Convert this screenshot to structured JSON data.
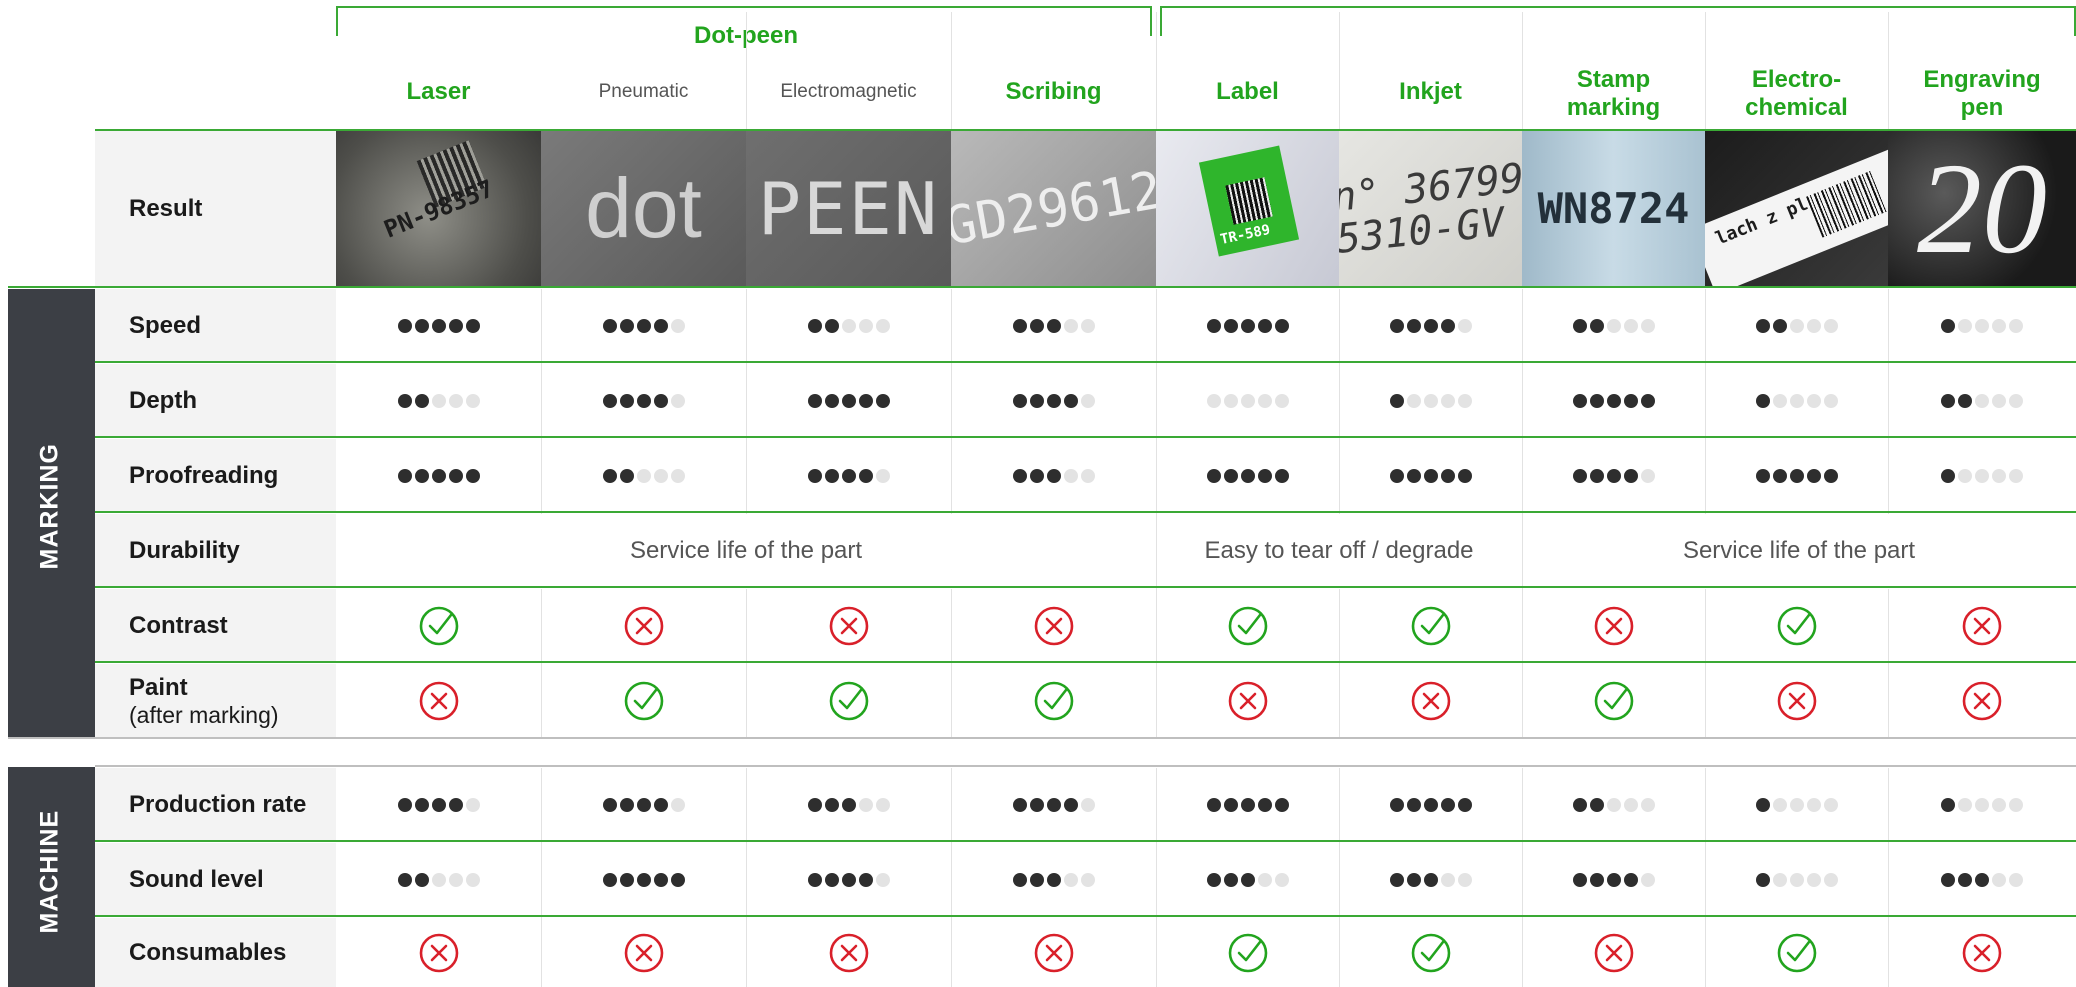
{
  "header": {
    "group_title": "Dot-peen",
    "columns": [
      "Laser",
      "Pneumatic",
      "Electromagnetic",
      "Scribing",
      "Label",
      "Inkjet",
      "Stamp marking",
      "Electro-chemical",
      "Engraving pen"
    ]
  },
  "result": {
    "label": "Result",
    "images": [
      {
        "text": "PN-98357",
        "note": "laser data matrix on metal"
      },
      {
        "text": "dot"
      },
      {
        "text": "PEEN"
      },
      {
        "text": "GD29612"
      },
      {
        "text": "TR-589"
      },
      {
        "text": "n° 36799\n5310-GV"
      },
      {
        "text": "WN8724"
      },
      {
        "text": "lach z pl"
      },
      {
        "text": "20"
      }
    ]
  },
  "sections": {
    "marking": "MARKING",
    "machine": "MACHINE"
  },
  "rows": {
    "speed": {
      "label": "Speed",
      "ratings": [
        5,
        4,
        2,
        3,
        5,
        4,
        2,
        2,
        1
      ]
    },
    "depth": {
      "label": "Depth",
      "ratings": [
        2,
        4,
        5,
        4,
        0,
        1,
        5,
        1,
        2
      ]
    },
    "proofreading": {
      "label": "Proofreading",
      "ratings": [
        5,
        2,
        4,
        3,
        5,
        5,
        4,
        5,
        1
      ]
    },
    "durability": {
      "label": "Durability",
      "groups": [
        "Service life of the part",
        "Easy to tear off / degrade",
        "Service life of the part"
      ]
    },
    "contrast": {
      "label": "Contrast",
      "values": [
        true,
        false,
        false,
        false,
        true,
        true,
        false,
        true,
        false
      ]
    },
    "paint": {
      "label": "Paint",
      "sublabel": "(after marking)",
      "values": [
        false,
        true,
        true,
        true,
        false,
        false,
        true,
        false,
        false
      ]
    },
    "production_rate": {
      "label": "Production rate",
      "ratings": [
        4,
        4,
        3,
        4,
        5,
        5,
        2,
        1,
        1
      ]
    },
    "sound_level": {
      "label": "Sound level",
      "ratings": [
        2,
        5,
        4,
        3,
        3,
        3,
        4,
        1,
        3
      ]
    },
    "consumables": {
      "label": "Consumables",
      "values": [
        false,
        false,
        false,
        false,
        true,
        true,
        false,
        true,
        false
      ]
    }
  },
  "colors": {
    "accent_green": "#22a41e",
    "cross_red": "#d9202a",
    "band": "#3c3f45",
    "dot_on": "#2e2e2e",
    "dot_off": "#e3e3e3"
  }
}
